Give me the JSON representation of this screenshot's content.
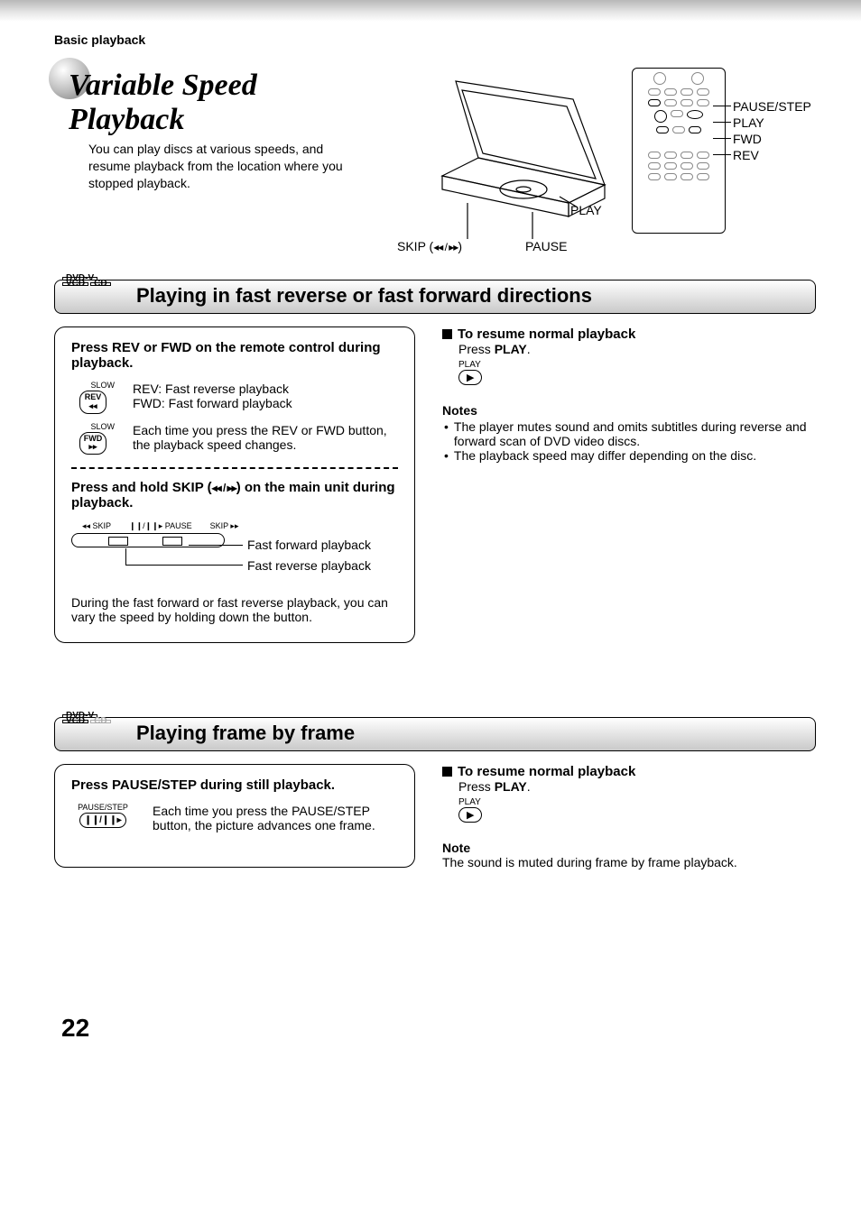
{
  "header": {
    "section": "Basic playback"
  },
  "hero": {
    "title": "Variable Speed Playback",
    "subtitle": "You can play discs at various speeds, and resume playback from the location where you stopped playback."
  },
  "device_labels": {
    "play": "PLAY",
    "skip_prefix": "SKIP (",
    "skip_glyphs": "◂◂ / ▸▸",
    "skip_suffix": ")",
    "pause": "PAUSE"
  },
  "remote_labels": {
    "pause_step": "PAUSE/STEP",
    "play": "PLAY",
    "fwd": "FWD",
    "rev": "REV"
  },
  "section1": {
    "title": "Playing in fast reverse or fast forward directions",
    "badges": {
      "dvdv": "DVD-V",
      "vcd": "VCD",
      "cd": "CD"
    },
    "left": {
      "head1": "Press REV or FWD on the remote control during playback.",
      "rev_label_top": "SLOW",
      "rev_label": "REV",
      "rev_sym": "◂◂",
      "fwd_label_top": "SLOW",
      "fwd_label": "FWD",
      "fwd_sym": "▸▸",
      "rev_desc": "REV:  Fast reverse playback",
      "fwd_desc": "FWD: Fast forward playback",
      "speed_desc": "Each time you press the REV or FWD button, the playback speed changes.",
      "head2_a": "Press and hold SKIP (",
      "head2_glyph": "◂◂ / ▸▸",
      "head2_b": ") on the main unit during playback.",
      "unit_labels": {
        "skip_l": "◂◂ SKIP",
        "pause": "❙❙/❙❙▸ PAUSE",
        "skip_r": "SKIP ▸▸"
      },
      "ff_label": "Fast forward playback",
      "fr_label": "Fast reverse playback",
      "tail": "During the fast forward or fast reverse playback, you can vary the speed by holding down the button."
    },
    "right": {
      "resume_head": "To resume normal playback",
      "resume_body_a": "Press ",
      "resume_body_b": "PLAY",
      "resume_body_c": ".",
      "play_icon_label": "PLAY",
      "play_icon_sym": "▶",
      "notes_head": "Notes",
      "notes": [
        "The player mutes sound and omits subtitles during reverse and forward scan of DVD video discs.",
        "The playback speed may differ depending on the disc."
      ]
    }
  },
  "section2": {
    "title": "Playing frame by frame",
    "badges": {
      "dvdv": "DVD-V",
      "vcd": "VCD",
      "cd": "CD"
    },
    "left": {
      "head": "Press PAUSE/STEP during still playback.",
      "btn_top": "PAUSE/STEP",
      "btn_sym": "❙❙/❙❙▸",
      "desc": "Each time you press the PAUSE/STEP button, the picture advances one frame."
    },
    "right": {
      "resume_head": "To resume normal playback",
      "resume_body_a": "Press ",
      "resume_body_b": "PLAY",
      "resume_body_c": ".",
      "play_icon_label": "PLAY",
      "play_icon_sym": "▶",
      "note_head": "Note",
      "note_body": "The sound is muted during frame by frame playback."
    }
  },
  "page_number": "22"
}
